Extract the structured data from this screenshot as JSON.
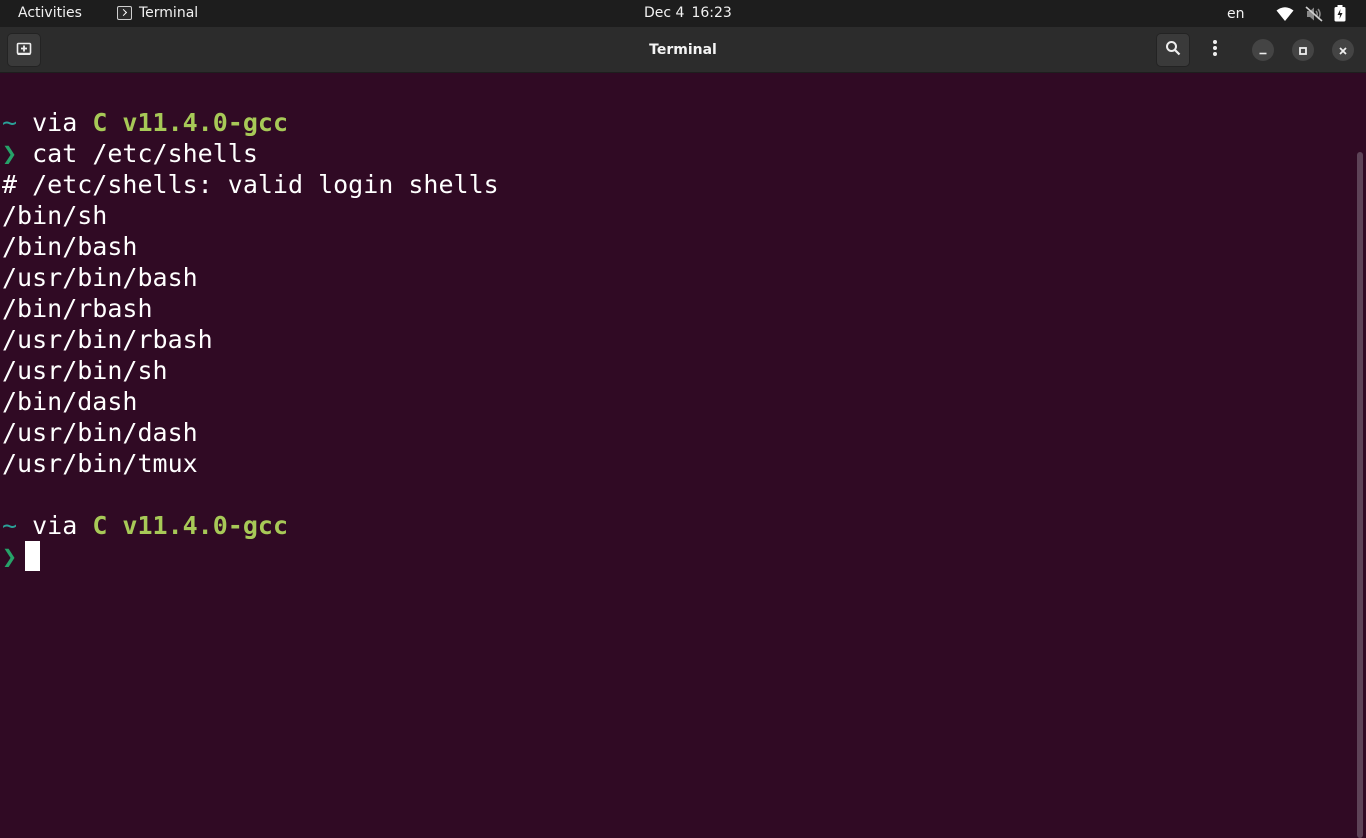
{
  "topbar": {
    "activities": "Activities",
    "app_name": "Terminal",
    "date": "Dec 4",
    "time": "16:23",
    "language": "en"
  },
  "window": {
    "title": "Terminal"
  },
  "icons": {
    "new_tab": "new-tab-icon",
    "search": "search-icon",
    "menu": "kebab-menu-icon",
    "minimize": "minimize-icon",
    "maximize": "maximize-icon",
    "close": "close-icon",
    "wifi": "wifi-icon",
    "sound": "sound-muted-icon",
    "battery": "battery-icon"
  },
  "colors": {
    "terminal_bg": "#300a24",
    "prompt_path": "#2aa198",
    "prompt_lang": "#a7c957",
    "prompt_arrow": "#26a269"
  },
  "terminal": {
    "prompt1": {
      "path": "~",
      "via": " via ",
      "lang": "C v11.4.0-gcc"
    },
    "arrow": "❯",
    "command": " cat /etc/shells",
    "output": [
      "# /etc/shells: valid login shells",
      "/bin/sh",
      "/bin/bash",
      "/usr/bin/bash",
      "/bin/rbash",
      "/usr/bin/rbash",
      "/usr/bin/sh",
      "/bin/dash",
      "/usr/bin/dash",
      "/usr/bin/tmux"
    ],
    "prompt2": {
      "path": "~",
      "via": " via ",
      "lang": "C v11.4.0-gcc"
    }
  }
}
